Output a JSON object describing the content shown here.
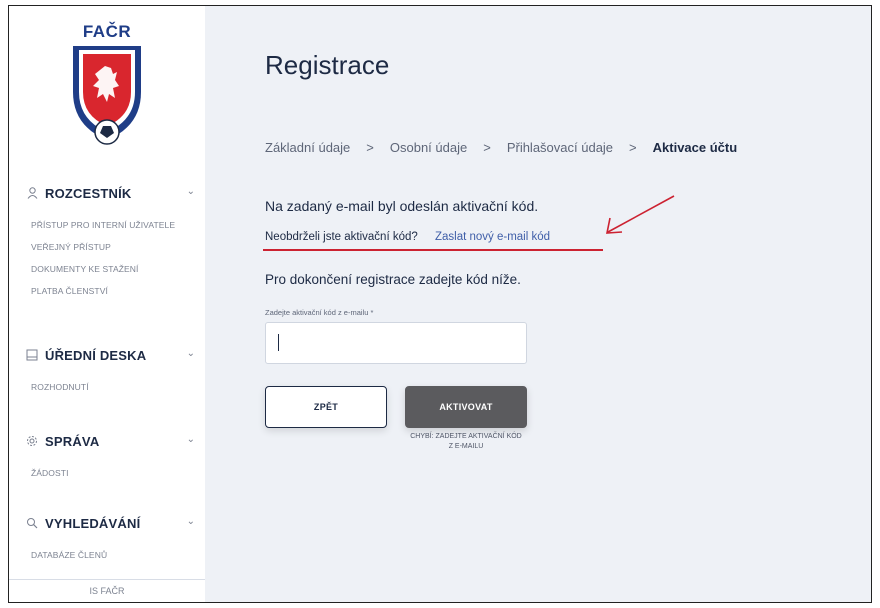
{
  "logo": {
    "text": "FAČR"
  },
  "sidebar": {
    "sections": [
      {
        "title": "ROZCESTNÍK",
        "icon": "user-icon",
        "items": [
          "PŘÍSTUP PRO INTERNÍ UŽIVATELE",
          "VEŘEJNÝ PŘÍSTUP",
          "DOKUMENTY KE STAŽENÍ",
          "PLATBA ČLENSTVÍ"
        ]
      },
      {
        "title": "ÚŘEDNÍ DESKA",
        "icon": "board-icon",
        "items": [
          "ROZHODNUTÍ"
        ]
      },
      {
        "title": "SPRÁVA",
        "icon": "gear-icon",
        "items": [
          "ŽÁDOSTI"
        ]
      },
      {
        "title": "VYHLEDÁVÁNÍ",
        "icon": "search-icon",
        "items": [
          "DATABÁZE ČLENŮ"
        ]
      }
    ],
    "footer": "IS FAČR"
  },
  "main": {
    "title": "Registrace",
    "steps": [
      "Základní údaje",
      "Osobní údaje",
      "Přihlašovací údaje",
      "Aktivace účtu"
    ],
    "step_separator": ">",
    "message": "Na zadaný e-mail byl odeslán aktivační kód.",
    "resend_question": "Neobdrželi jste aktivační kód?",
    "resend_link": "Zaslat nový e-mail kód",
    "instruction": "Pro dokončení registrace zadejte kód níže.",
    "code_field": {
      "label": "Zadejte aktivační kód z e-mailu *",
      "value": ""
    },
    "back_button": "ZPĚT",
    "activate_button": "AKTIVOVAT",
    "error_line1": "CHYBÍ: ZADEJTE AKTIVAČNÍ KÓD",
    "error_line2": "Z E-MAILU"
  },
  "annotation": {
    "color": "#cc2231"
  }
}
